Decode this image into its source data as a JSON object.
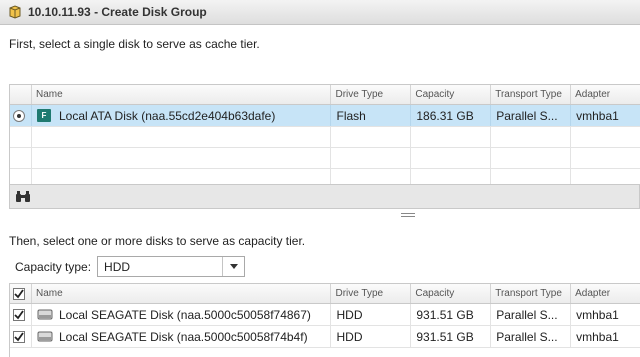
{
  "window": {
    "title": "10.10.11.93 - Create Disk Group"
  },
  "cache": {
    "instruction": "First, select a single disk to serve as cache tier.",
    "columns": [
      "Name",
      "Drive Type",
      "Capacity",
      "Transport Type",
      "Adapter"
    ],
    "rows": [
      {
        "name": "Local ATA Disk (naa.55cd2e404b63dafe)",
        "drive_type": "Flash",
        "capacity": "186.31 GB",
        "transport": "Parallel S...",
        "adapter": "vmhba1",
        "selected": true,
        "icon_letter": "F"
      }
    ]
  },
  "capacity": {
    "instruction": "Then, select one or more disks to serve as capacity tier.",
    "type_label": "Capacity type:",
    "type_value": "HDD",
    "columns": [
      "Name",
      "Drive Type",
      "Capacity",
      "Transport Type",
      "Adapter"
    ],
    "rows": [
      {
        "name": "Local SEAGATE Disk (naa.5000c50058f74867)",
        "drive_type": "HDD",
        "capacity": "931.51 GB",
        "transport": "Parallel S...",
        "adapter": "vmhba1",
        "checked": true
      },
      {
        "name": "Local SEAGATE Disk (naa.5000c50058f74b4f)",
        "drive_type": "HDD",
        "capacity": "931.51 GB",
        "transport": "Parallel S...",
        "adapter": "vmhba1",
        "checked": true
      }
    ]
  },
  "icons": {
    "title": "disk-group-icon",
    "toolbar": "binoculars-icon",
    "select": "chevron-down-icon",
    "disk": "hdd-icon"
  }
}
